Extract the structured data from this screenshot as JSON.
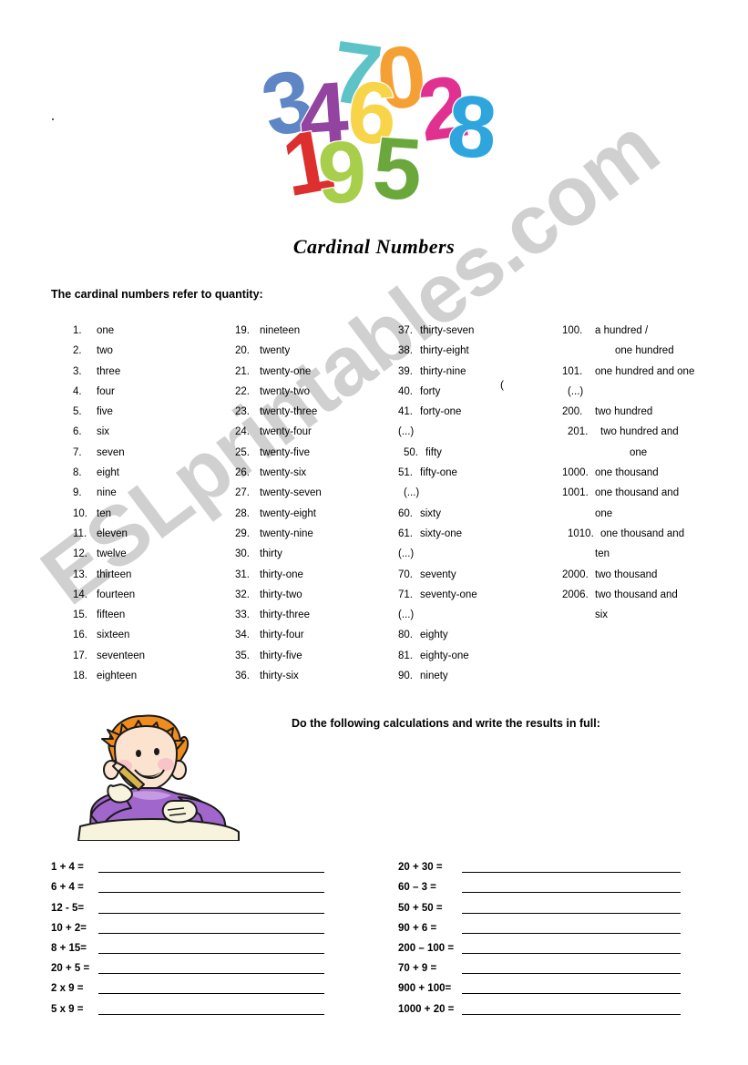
{
  "document": {
    "title": "Cardinal Numbers",
    "intro": "The cardinal numbers refer to quantity:",
    "exercise_instruction": "Do the following calculations and write the results in full:",
    "watermark": "ESLprintables.com",
    "stray_paren": "("
  },
  "art": {
    "numbers_graphic_name": "colorful-3d-numbers",
    "digits": [
      "3",
      "4",
      "7",
      "0",
      "6",
      "2",
      "1",
      "9",
      "5",
      "8"
    ],
    "colors": {
      "three": "#6b9bd2",
      "four": "#9b4f9e",
      "seven": "#5bc8c8",
      "zero": "#f5a03c",
      "six": "#f5d54a",
      "two": "#e0348c",
      "one": "#e03030",
      "nine": "#a8d04a",
      "five": "#6aa83c",
      "eight": "#2fa8dc",
      "outline": "#ffffff"
    },
    "boy_name": "boy-writing-at-desk",
    "boy_colors": {
      "hair": "#f08c1e",
      "skin": "#fbe3d0",
      "cheek": "#f6c4c9",
      "shirt": "#a066cc",
      "shirt_light": "#c49ae0",
      "pencil": "#d8b44a",
      "paper": "#f7f3dd",
      "outline": "#1a1a1a"
    }
  },
  "columns": [
    {
      "name": "column-1",
      "entries": [
        {
          "num": "1.",
          "word": "one"
        },
        {
          "num": "2.",
          "word": "two"
        },
        {
          "num": "3.",
          "word": "three"
        },
        {
          "num": "4.",
          "word": "four"
        },
        {
          "num": "5.",
          "word": "five"
        },
        {
          "num": "6.",
          "word": "six"
        },
        {
          "num": "7.",
          "word": "seven"
        },
        {
          "num": "8.",
          "word": "eight"
        },
        {
          "num": "9.",
          "word": "nine"
        },
        {
          "num": "10.",
          "word": "ten"
        },
        {
          "num": "11.",
          "word": "eleven"
        },
        {
          "num": "12.",
          "word": "twelve"
        },
        {
          "num": "13.",
          "word": "thirteen"
        },
        {
          "num": "14.",
          "word": "fourteen"
        },
        {
          "num": "15.",
          "word": "fifteen"
        },
        {
          "num": "16.",
          "word": "sixteen"
        },
        {
          "num": "17.",
          "word": "seventeen"
        },
        {
          "num": "18.",
          "word": "eighteen"
        }
      ]
    },
    {
      "name": "column-2",
      "entries": [
        {
          "num": "19.",
          "word": "nineteen"
        },
        {
          "num": "20.",
          "word": "twenty"
        },
        {
          "num": "21.",
          "word": "twenty-one"
        },
        {
          "num": "22.",
          "word": "twenty-two"
        },
        {
          "num": "23.",
          "word": "twenty-three"
        },
        {
          "num": "24.",
          "word": "twenty-four"
        },
        {
          "num": "25.",
          "word": "twenty-five"
        },
        {
          "num": "26.",
          "word": "twenty-six"
        },
        {
          "num": "27.",
          "word": "twenty-seven"
        },
        {
          "num": "28.",
          "word": "twenty-eight"
        },
        {
          "num": "29.",
          "word": "twenty-nine"
        },
        {
          "num": "30.",
          "word": "thirty"
        },
        {
          "num": "31.",
          "word": "thirty-one"
        },
        {
          "num": "32.",
          "word": "thirty-two"
        },
        {
          "num": "33.",
          "word": "thirty-three"
        },
        {
          "num": "34.",
          "word": "thirty-four"
        },
        {
          "num": "35.",
          "word": "thirty-five"
        },
        {
          "num": "36.",
          "word": "thirty-six"
        }
      ]
    },
    {
      "name": "column-3",
      "entries": [
        {
          "num": "37.",
          "word": "thirty-seven"
        },
        {
          "num": "38.",
          "word": "thirty-eight"
        },
        {
          "num": "39.",
          "word": "thirty-nine"
        },
        {
          "num": "40.",
          "word": "forty"
        },
        {
          "num": "41.",
          "word": "forty-one"
        },
        {
          "num": "(...)",
          "word": "",
          "style": "ellipsis"
        },
        {
          "num": "50.",
          "word": "fifty",
          "style": "indent"
        },
        {
          "num": "51.",
          "word": "fifty-one"
        },
        {
          "num": "(...)",
          "word": "",
          "style": "ellipsis indent"
        },
        {
          "num": "60.",
          "word": "sixty"
        },
        {
          "num": "61.",
          "word": "sixty-one"
        },
        {
          "num": "(...)",
          "word": "",
          "style": "ellipsis"
        },
        {
          "num": "70.",
          "word": "seventy"
        },
        {
          "num": "71.",
          "word": "seventy-one"
        },
        {
          "num": "(...)",
          "word": "",
          "style": "ellipsis"
        },
        {
          "num": "80.",
          "word": "eighty"
        },
        {
          "num": "81.",
          "word": "eighty-one"
        },
        {
          "num": "90.",
          "word": "ninety"
        }
      ]
    },
    {
      "name": "column-4",
      "entries": [
        {
          "num": "100.",
          "word": "a hundred /"
        },
        {
          "num": "",
          "word": "one hundred",
          "style": "cont"
        },
        {
          "num": "101.",
          "word": "one hundred and one"
        },
        {
          "num": "(...)",
          "word": "",
          "style": "ellipsis indent"
        },
        {
          "num": "200.",
          "word": "two hundred"
        },
        {
          "num": "201.",
          "word": "two hundred and",
          "style": "indent"
        },
        {
          "num": "",
          "word": "one",
          "style": "cont2"
        },
        {
          "num": "1000.",
          "word": "one thousand"
        },
        {
          "num": "1001.",
          "word": "one thousand and"
        },
        {
          "num": "",
          "word": "one",
          "style": "flush"
        },
        {
          "num": "1010.",
          "word": "one thousand and",
          "style": "indent"
        },
        {
          "num": "",
          "word": "ten",
          "style": "flush"
        },
        {
          "num": "2000.",
          "word": "two thousand"
        },
        {
          "num": "2006.",
          "word": "two thousand and"
        },
        {
          "num": "",
          "word": "six",
          "style": "flush"
        }
      ]
    }
  ],
  "exercises": {
    "left": [
      "1 + 4 =",
      "6 + 4 =",
      "12  - 5=",
      "10 + 2=",
      "8 + 15=",
      "20 + 5 =",
      "2 x 9 =",
      "5 x 9 ="
    ],
    "right": [
      "20 + 30 =",
      "60 – 3 =",
      "50 + 50 =",
      "90 + 6 =",
      "200 – 100 =",
      "70 + 9 =",
      "900 + 100=",
      "1000 + 20 ="
    ]
  }
}
